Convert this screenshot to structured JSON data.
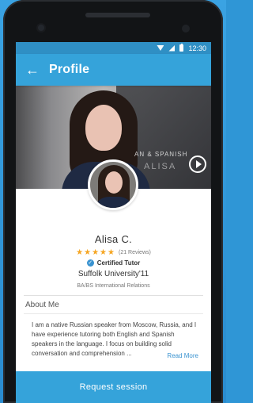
{
  "statusbar": {
    "time": "12:30",
    "wifi_icon": "wifi-icon",
    "signal_icon": "signal-icon",
    "battery_icon": "battery-icon"
  },
  "appbar": {
    "back_icon": "back-arrow-icon",
    "back_glyph": "←",
    "title": "Profile"
  },
  "video": {
    "caption_line1": "AN & SPANISH",
    "caption_line2": "ALISA",
    "play_icon": "play-icon"
  },
  "profile": {
    "name": "Alisa C.",
    "stars": "★★★★★",
    "rating_stars": 5,
    "reviews": "(21 Reviews)",
    "certified_icon": "checkmark-badge-icon",
    "certified_glyph": "✓",
    "certified": "Certified Tutor",
    "university": "Suffolk University'11",
    "degree": "BA/BS International Relations"
  },
  "about": {
    "title": "About Me",
    "text": "I am a native Russian speaker from Moscow, Russia, and I have experience tutoring both English and Spanish speakers in the language. I focus on building solid conversation and comprehension ...",
    "read_more": "Read More"
  },
  "actions": {
    "request": "Request session"
  },
  "colors": {
    "primary": "#35a3da",
    "status_bar": "#2f8fc4",
    "star": "#f5a623",
    "link": "#3a93d0"
  }
}
